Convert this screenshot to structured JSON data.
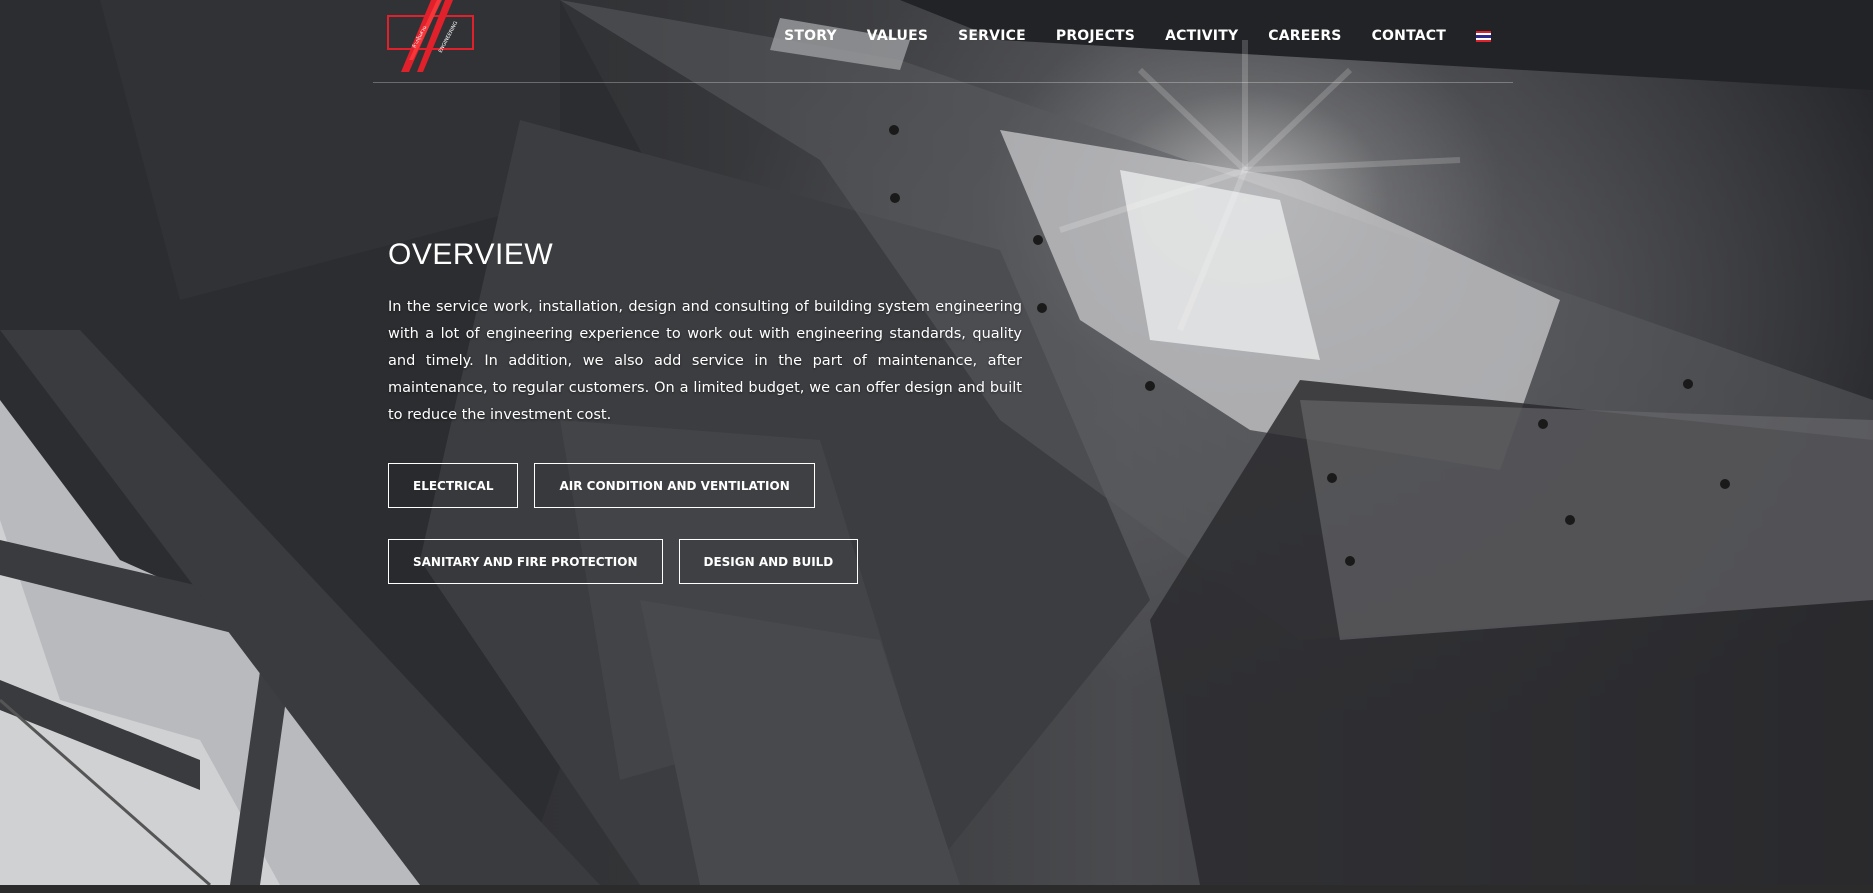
{
  "brand": {
    "logo_text_top": "ห้างหุ้นส่วนจำกัด",
    "logo_text_bottom": "ENGINEERING CO.,LTD.",
    "accent_color": "#e0202a"
  },
  "nav": {
    "items": [
      {
        "label": "STORY"
      },
      {
        "label": "VALUES"
      },
      {
        "label": "SERVICE"
      },
      {
        "label": "PROJECTS"
      },
      {
        "label": "ACTIVITY"
      },
      {
        "label": "CAREERS"
      },
      {
        "label": "CONTACT"
      }
    ],
    "language_flag": "thai-flag-icon"
  },
  "overview": {
    "title": "OVERVIEW",
    "description": "In the service work, installation, design and consulting of building system engineering with a lot of engineering experience to work out with engineering standards, quality and timely. In addition, we also add service in the part of maintenance, after maintenance, to regular customers. On a limited budget, we can offer design and built to reduce the investment cost."
  },
  "services": {
    "row1": [
      {
        "label": "ELECTRICAL"
      },
      {
        "label": "AIR CONDITION AND VENTILATION"
      }
    ],
    "row2": [
      {
        "label": "SANITARY AND FIRE PROTECTION"
      },
      {
        "label": "DESIGN AND BUILD"
      }
    ]
  }
}
